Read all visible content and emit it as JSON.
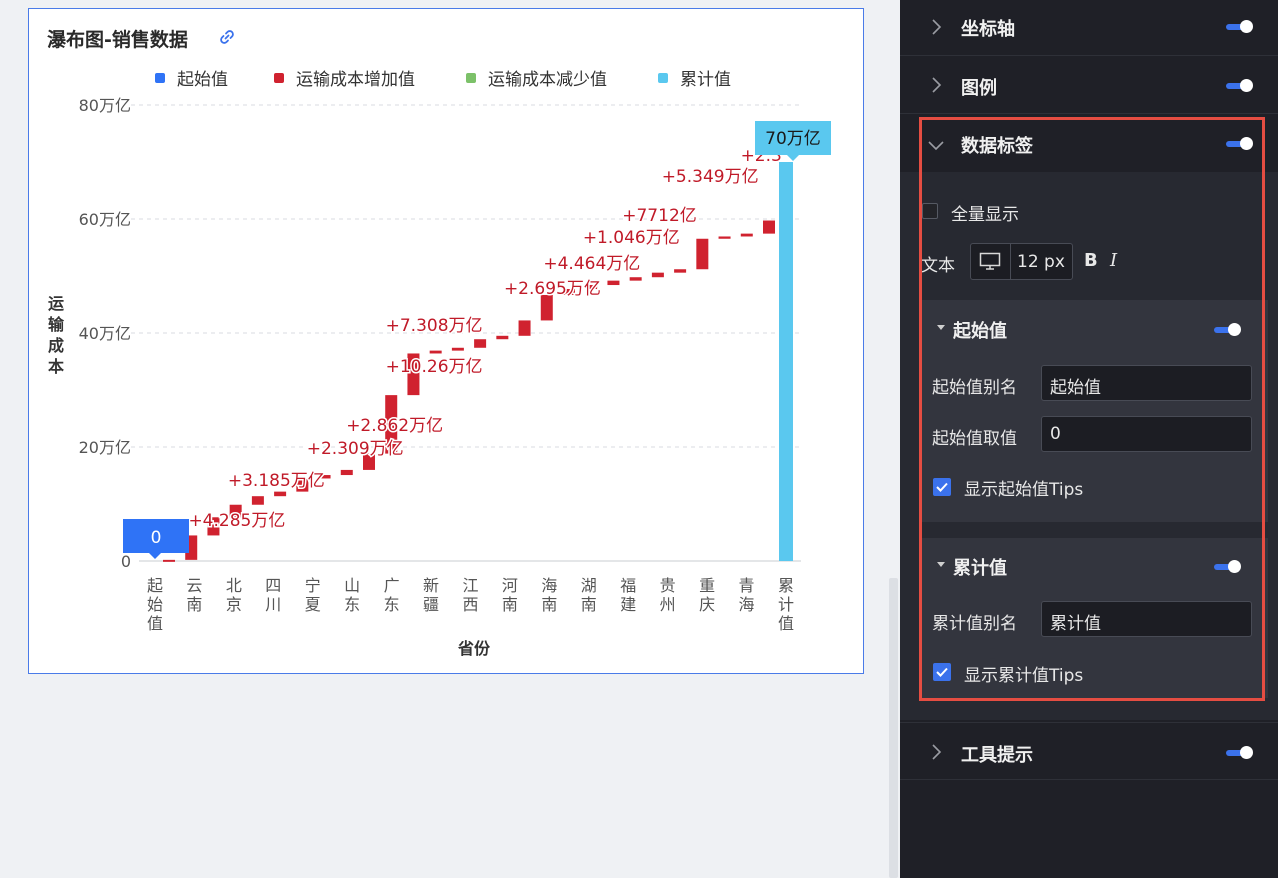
{
  "chart_card": {
    "title": "瀑布图-销售数据",
    "link_icon": "link-icon"
  },
  "chart_data": {
    "type": "waterfall",
    "title": "瀑布图-销售数据",
    "xlabel": "省份",
    "ylabel": "运输成本",
    "ylim": [
      0,
      80
    ],
    "y_unit": "万亿",
    "y_ticks": [
      "0",
      "20万亿",
      "40万亿",
      "60万亿",
      "80万亿"
    ],
    "legend": [
      "起始值",
      "运输成本增加值",
      "运输成本减少值",
      "累计值"
    ],
    "legend_position": "top",
    "colors": {
      "start": "#2f73f6",
      "increase": "#d0222f",
      "decrease": "#7cc169",
      "total": "#5ac8ef"
    },
    "grid": true,
    "categories": [
      "起始值",
      "云南",
      "北京",
      "四川",
      "宁夏",
      "山东",
      "广东",
      "新疆",
      "江西",
      "河南",
      "海南",
      "湖南",
      "福建",
      "贵州",
      "重庆",
      "青海",
      "累计值"
    ],
    "increments": [
      0.2,
      4.285,
      3.185,
      2.2,
      1.5,
      0.8,
      2.309,
      0.6,
      0.9,
      2.862,
      10.26,
      7.308,
      0.5,
      0.5,
      1.5,
      0.6,
      2.695,
      4.464,
      1.046,
      0.7,
      0.771,
      0.6,
      0.8,
      0.6,
      5.349,
      0.4,
      0.5,
      2.3
    ],
    "bar_labels": [
      {
        "category": "云南",
        "text": "+4.285万亿"
      },
      {
        "category": "北京",
        "text": "+3.185万亿"
      },
      {
        "category": "宁夏",
        "text": "+2.309万亿"
      },
      {
        "category": "山东",
        "text": "+2.862万亿"
      },
      {
        "category": "广东",
        "text": "+10.26万亿"
      },
      {
        "category": "广东",
        "text": "+7.308万亿"
      },
      {
        "category": "河南",
        "text": "+2.695万亿"
      },
      {
        "category": "海南",
        "text": "+4.464万亿"
      },
      {
        "category": "湖南",
        "text": "+1.046万亿"
      },
      {
        "category": "福建",
        "text": "+7712亿"
      },
      {
        "category": "贵州",
        "text": "+5.349万亿"
      },
      {
        "category": "青海",
        "text": "+2.3"
      }
    ],
    "start_tip": "0",
    "total_tip": "70万亿",
    "total_value": 70
  },
  "panel": {
    "sections": [
      {
        "label": "坐标轴",
        "expanded": false,
        "enabled": true
      },
      {
        "label": "图例",
        "expanded": false,
        "enabled": true
      },
      {
        "label": "数据标签",
        "expanded": true,
        "enabled": true
      },
      {
        "label": "工具提示",
        "expanded": false,
        "enabled": true
      }
    ],
    "show_all_label": "全量显示",
    "show_all_checked": false,
    "text_label": "文本",
    "font_size": "12 px",
    "bold_label": "B",
    "italic_label": "I",
    "start_section": {
      "title": "起始值",
      "alias_label": "起始值别名",
      "alias_value": "起始值",
      "value_label": "起始值取值",
      "value_value": "0",
      "tips_label": "显示起始值Tips",
      "tips_checked": true
    },
    "total_section": {
      "title": "累计值",
      "alias_label": "累计值别名",
      "alias_value": "累计值",
      "tips_label": "显示累计值Tips",
      "tips_checked": true
    }
  }
}
